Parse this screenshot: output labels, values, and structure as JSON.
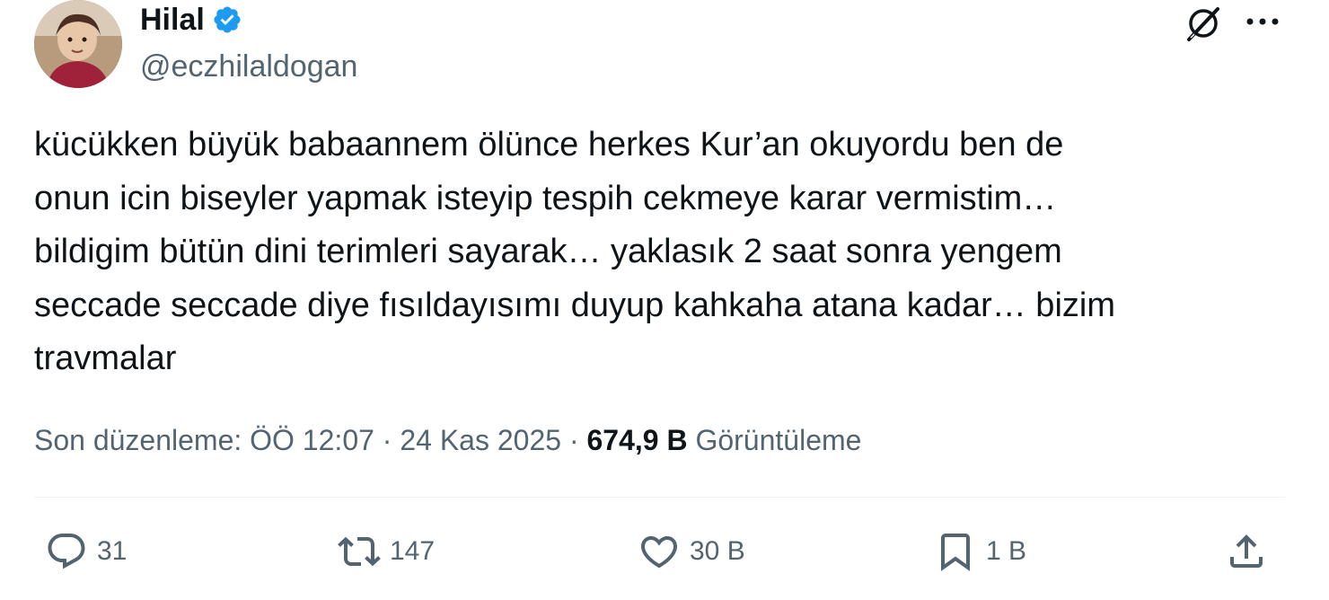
{
  "author": {
    "name": "Hilal",
    "handle": "@eczhilaldogan",
    "avatar_icon": "child-photo-avatar",
    "verified_icon": "verified-badge-icon",
    "verified_color": "#1d9bf0"
  },
  "header_actions": {
    "grok_icon": "grok-icon",
    "more_icon": "more-dots-icon"
  },
  "tweet": {
    "text": "kücükken büyük babaannem ölünce herkes Kur’an okuyordu ben de\nonun icin biseyler yapmak isteyip tespih cekmeye karar vermistim…\nbildigim bütün dini terimleri sayarak… yaklasık 2 saat sonra yengem\nseccade seccade diye fısıldayısımı duyup kahkaha atana kadar… bizim\ntravmalar"
  },
  "meta": {
    "edited_label": "Son düzenleme: ÖÖ 12:07 · 24 Kas 2025 · ",
    "views_count": "674,9 B",
    "views_label": "Görüntüleme"
  },
  "actions": {
    "reply_count": "31",
    "retweet_count": "147",
    "like_count": "30 B",
    "bookmark_count": "1 B"
  },
  "colors": {
    "text_primary": "#0f1419",
    "text_secondary": "#536471",
    "divider": "#eff3f4"
  }
}
